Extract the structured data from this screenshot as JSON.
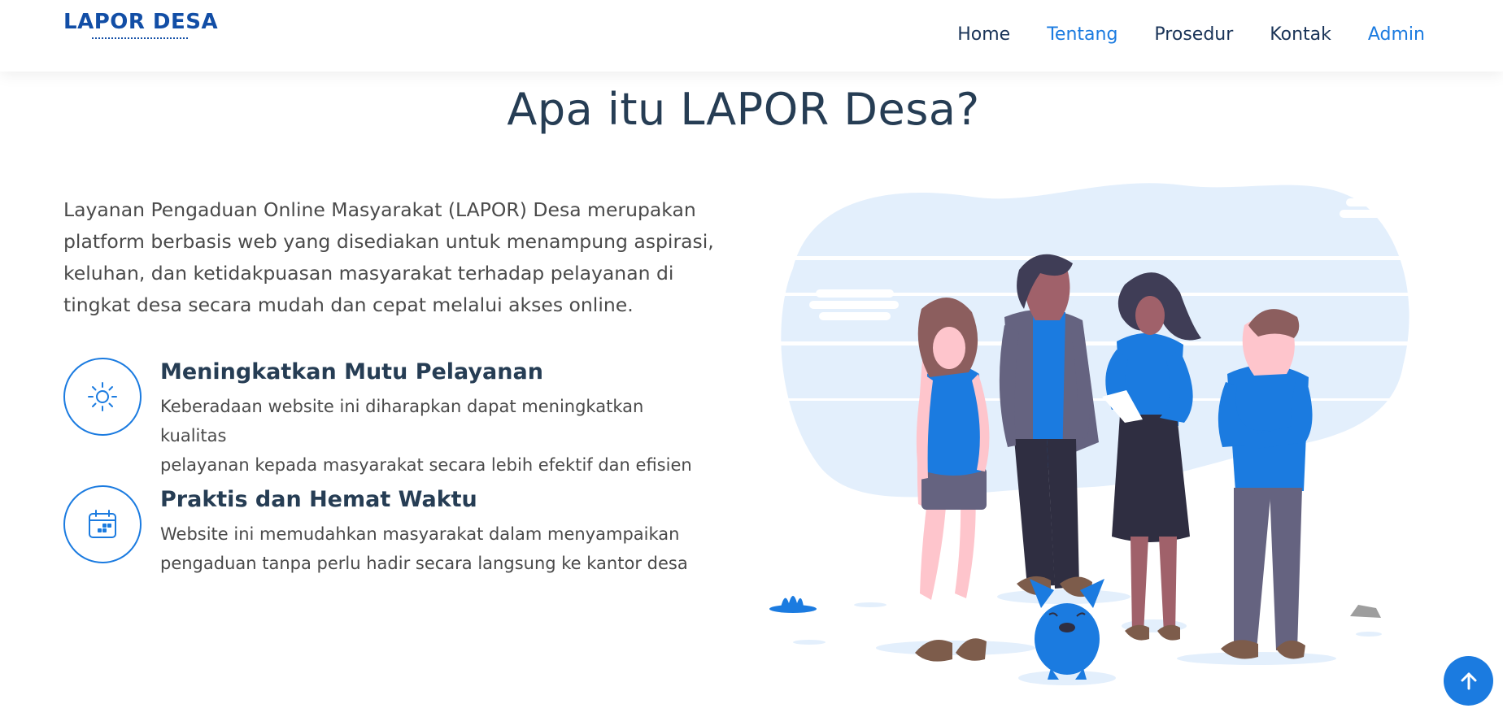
{
  "header": {
    "logo": "LAPOR DESA",
    "nav": [
      {
        "label": "Home"
      },
      {
        "label": "Tentang"
      },
      {
        "label": "Prosedur"
      },
      {
        "label": "Kontak"
      },
      {
        "label": "Admin"
      }
    ]
  },
  "main": {
    "title": "Apa itu LAPOR Desa?",
    "intro": "Layanan Pengaduan Online Masyarakat (LAPOR) Desa merupakan platform berbasis web yang disediakan untuk menampung aspirasi, keluhan, dan ketidakpuasan masyarakat terhadap pelayanan di tingkat desa secara mudah dan cepat melalui akses online.",
    "features": [
      {
        "icon": "sun-icon",
        "title": "Meningkatkan Mutu Pelayanan",
        "desc_line1": "Keberadaan website ini diharapkan dapat meningkatkan kualitas",
        "desc_line2": "pelayanan kepada masyarakat secara lebih efektif dan efisien"
      },
      {
        "icon": "calendar-icon",
        "title": "Praktis dan Hemat Waktu",
        "desc_line1": "Website ini memudahkan masyarakat dalam menyampaikan",
        "desc_line2": "pengaduan tanpa perlu hadir secara langsung ke kantor desa"
      }
    ]
  },
  "illustration": {
    "icon": "team-illustration"
  },
  "back_to_top": {
    "icon": "arrow-up-icon"
  },
  "colors": {
    "brand": "#124ea6",
    "accent": "#1b7be0",
    "heading": "#263d54",
    "text": "#4a4a4a",
    "illustration_bg": "#e3effc"
  }
}
